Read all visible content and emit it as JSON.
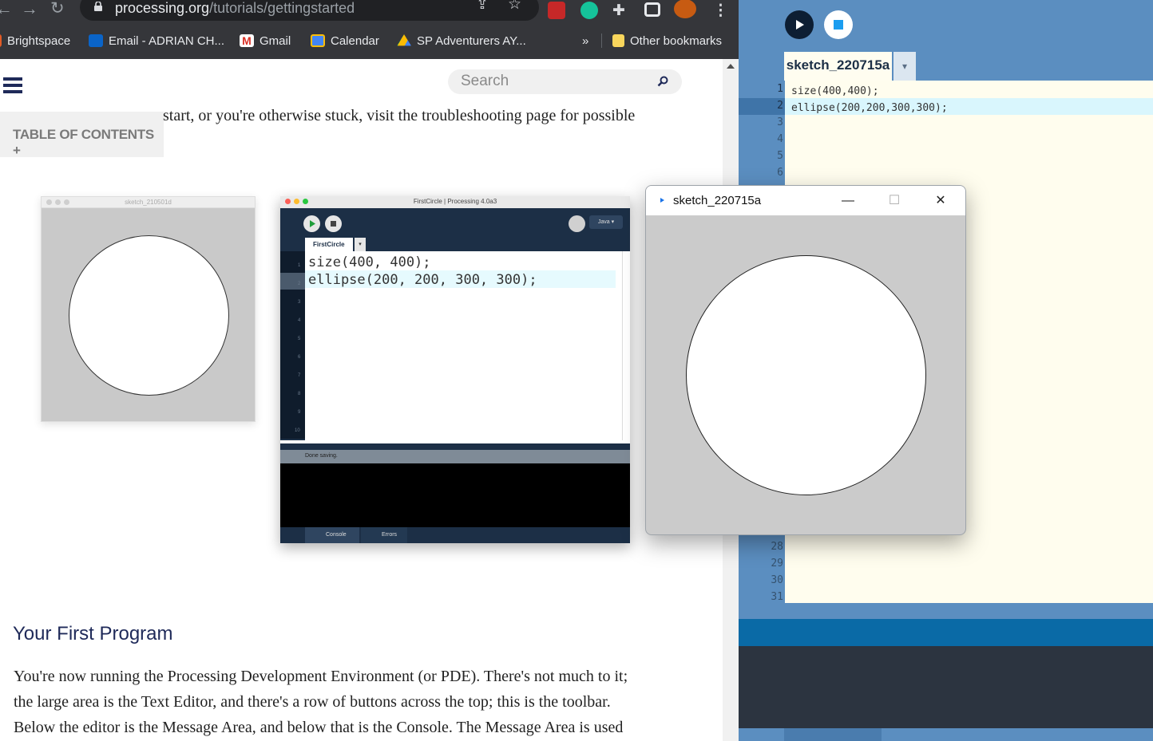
{
  "browser": {
    "url_host": "processing.org",
    "url_path": "/tutorials/gettingstarted",
    "bookmarks": [
      "Brightspace",
      "Email - ADRIAN CH...",
      "Gmail",
      "Calendar",
      "SP Adventurers AY...",
      "»",
      "Other bookmarks"
    ]
  },
  "page": {
    "search_placeholder": "Search",
    "toc_label": "TABLE OF CONTENTS +",
    "intro_text": "start, or you're otherwise stuck, visit the troubleshooting page for possible",
    "heading": "Your First Program",
    "paragraph_lines": [
      "You're now running the Processing Development Environment (or PDE). There's not much to it;",
      "the large area is the Text Editor, and there's a row of buttons across the top; this is the toolbar.",
      "Below the editor is the Message Area, and below that is the Console. The Message Area is used"
    ],
    "figure1": {
      "title": "sketch_210501d"
    },
    "figure2": {
      "title": "FirstCircle | Processing 4.0a3",
      "tab": "FirstCircle",
      "tab_menu": "▾",
      "mode": "Java ▾",
      "code_lines": [
        "size(400, 400);",
        "ellipse(200, 200, 300, 300);"
      ],
      "line_numbers": [
        "1",
        "2",
        "3",
        "4",
        "5",
        "6",
        "7",
        "8",
        "9",
        "10"
      ],
      "status": "Done saving.",
      "console_tab": "Console",
      "errors_tab": "Errors"
    }
  },
  "pde": {
    "tab": "sketch_220715a",
    "tab_menu": "▾",
    "code_lines": [
      "size(400,400);",
      "ellipse(200,200,300,300);"
    ],
    "top_line_numbers": [
      "1",
      "2",
      "3",
      "4",
      "5",
      "6"
    ],
    "bottom_line_numbers": [
      "28",
      "29",
      "30",
      "31"
    ]
  },
  "sketch_window": {
    "title": "sketch_220715a",
    "minimize": "—",
    "maximize": "☐",
    "close": "✕"
  },
  "colors": {
    "chrome_bar": "#35363a",
    "heading": "#1f2a59",
    "pde_blue": "#5b8ec0",
    "pde_status": "#0a6aa6"
  }
}
